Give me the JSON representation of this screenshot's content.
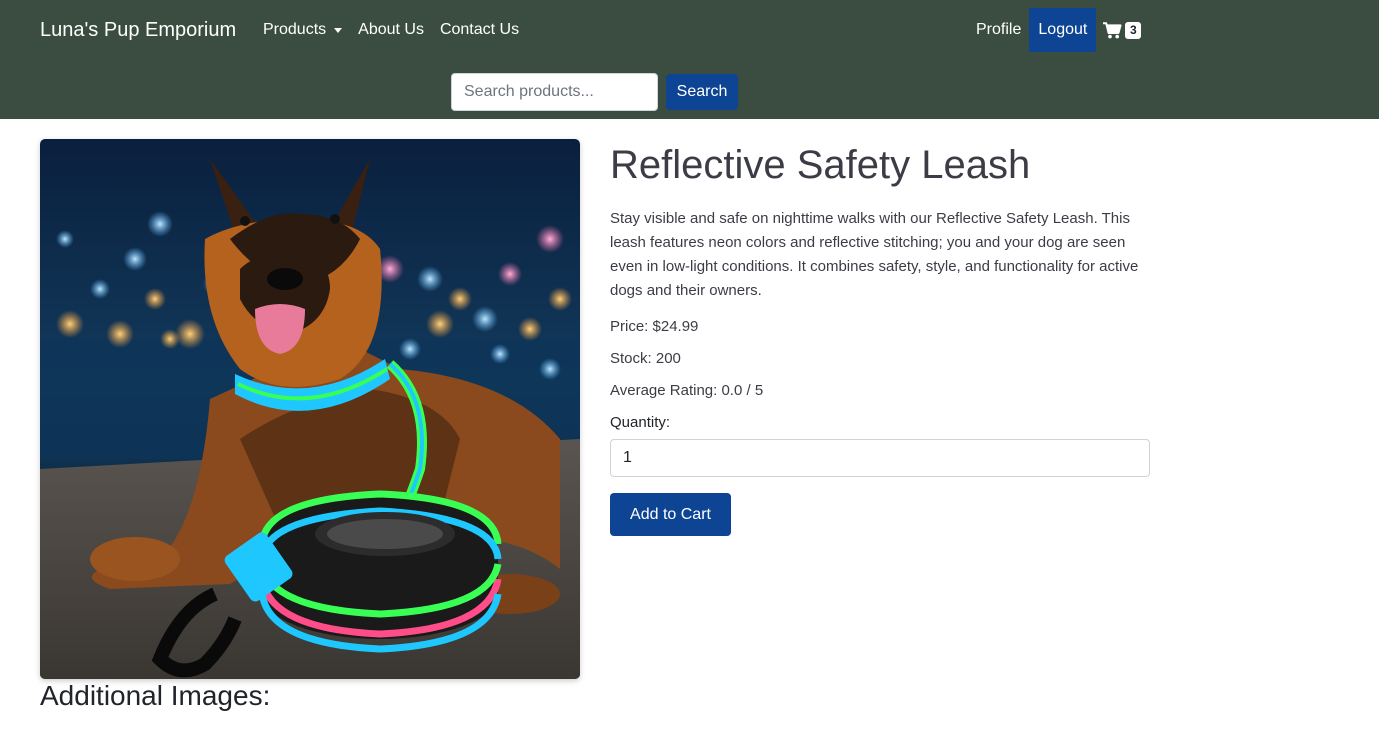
{
  "navbar": {
    "brand": "Luna's Pup Emporium",
    "links": [
      {
        "label": "Products"
      },
      {
        "label": "About Us"
      },
      {
        "label": "Contact Us"
      }
    ],
    "profile_label": "Profile",
    "logout_label": "Logout",
    "cart_icon": "shopping-cart-icon",
    "cart_count": "3",
    "search_placeholder": "Search products...",
    "search_button": "Search"
  },
  "product": {
    "title": "Reflective Safety Leash",
    "description": "Stay visible and safe on nighttime walks with our Reflective Safety Leash. This leash features neon colors and reflective stitching; you and your dog are seen even in low-light conditions. It combines safety, style, and functionality for active dogs and their owners.",
    "price_text": "Price: $24.99",
    "stock_text": "Stock: 200",
    "rating_text": "Average Rating: 0.0 / 5",
    "quantity_label": "Quantity:",
    "quantity_value": "1",
    "add_to_cart_label": "Add to Cart"
  },
  "additional_images_heading": "Additional Images:",
  "colors": {
    "navbar_bg": "#3a4d40",
    "primary_button": "#0d4594",
    "text": "#3c3c46"
  }
}
